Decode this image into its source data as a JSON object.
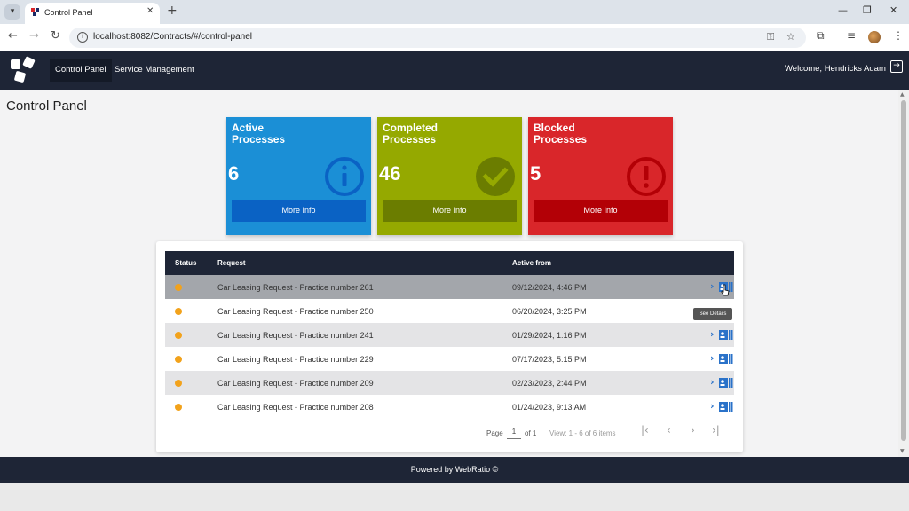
{
  "browser": {
    "tab_title": "Control Panel",
    "tab_close": "✕",
    "new_tab": "+",
    "url": "localhost:8082/Contracts/#/control-panel",
    "win_minimize": "—",
    "win_restore": "❐",
    "win_close": "✕"
  },
  "header": {
    "nav": [
      {
        "label": "Control Panel",
        "active": true
      },
      {
        "label": "Service Management",
        "active": false
      }
    ],
    "welcome": "Welcome, Hendricks Adam"
  },
  "page": {
    "title": "Control Panel"
  },
  "cards": [
    {
      "title_line1": "Active",
      "title_line2": "Processes",
      "count": "6",
      "button": "More Info",
      "color": "#1b8fd6",
      "button_color": "#0a62c4",
      "icon": "info-icon"
    },
    {
      "title_line1": "Completed",
      "title_line2": "Processes",
      "count": "46",
      "button": "More Info",
      "color": "#95a900",
      "button_color": "#6b7d00",
      "icon": "check-icon"
    },
    {
      "title_line1": "Blocked",
      "title_line2": "Processes",
      "count": "5",
      "button": "More Info",
      "color": "#d9262a",
      "button_color": "#b30006",
      "icon": "exclamation-icon"
    }
  ],
  "table": {
    "headers": {
      "status": "Status",
      "request": "Request",
      "active_from": "Active from"
    },
    "rows": [
      {
        "request": "Car Leasing Request - Practice number 261",
        "active_from": "09/12/2024, 4:46 PM"
      },
      {
        "request": "Car Leasing Request - Practice number 250",
        "active_from": "06/20/2024, 3:25 PM"
      },
      {
        "request": "Car Leasing Request - Practice number 241",
        "active_from": "01/29/2024, 1:16 PM"
      },
      {
        "request": "Car Leasing Request - Practice number 229",
        "active_from": "07/17/2023, 5:15 PM"
      },
      {
        "request": "Car Leasing Request - Practice number 209",
        "active_from": "02/23/2023, 2:44 PM"
      },
      {
        "request": "Car Leasing Request - Practice number 208",
        "active_from": "01/24/2023, 9:13 AM"
      }
    ],
    "tooltip": "See Details",
    "status_color": "#f2a21b"
  },
  "pager": {
    "page_label": "Page",
    "page_value": "1",
    "of_label": "of 1",
    "view_label": "View: 1 - 6 of 6 items"
  },
  "footer": {
    "text": "Powered by WebRatio ©"
  }
}
